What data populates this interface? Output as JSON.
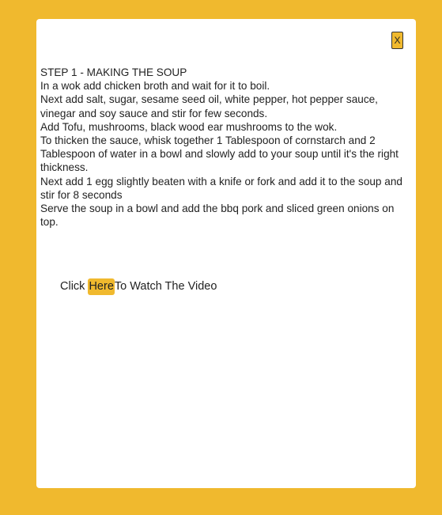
{
  "modal": {
    "close_label": "X",
    "step_title": "STEP 1 - MAKING THE SOUP",
    "steps": [
      "In a wok add chicken broth and wait for it to boil.",
      "Next add salt, sugar, sesame seed oil, white pepper, hot pepper sauce, vinegar and soy sauce and stir for few seconds.",
      "Add Tofu, mushrooms, black wood ear mushrooms to the wok.",
      "To thicken the sauce, whisk together 1 Tablespoon of cornstarch and 2 Tablespoon of water in a bowl and slowly add to your soup until it's the right thickness.",
      "Next add 1 egg slightly beaten with a knife or fork and add it to the soup and stir for 8 seconds",
      "Serve the soup in a bowl and add the bbq pork and sliced green onions on top."
    ],
    "video": {
      "prefix": "Click ",
      "link_label": "Here",
      "suffix": "To Watch The Video"
    }
  },
  "colors": {
    "background": "#f0b92e",
    "accent": "#f0b92e",
    "panel": "#ffffff",
    "text": "#222222"
  }
}
